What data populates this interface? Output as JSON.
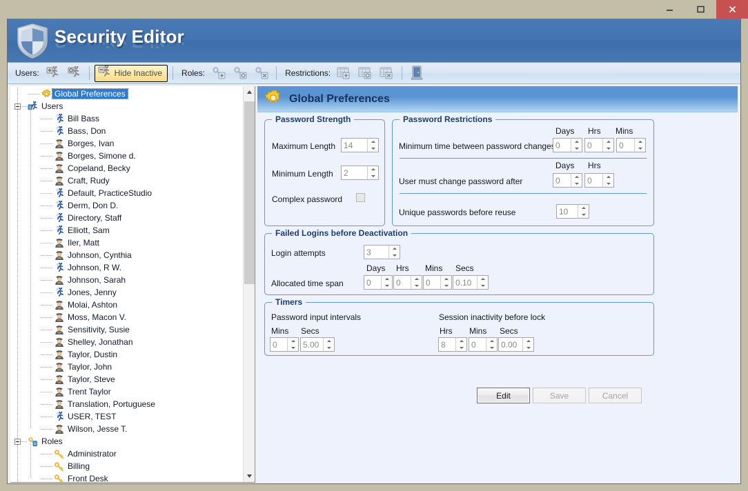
{
  "window": {
    "minimize_label": "Minimize",
    "maximize_label": "Maximize",
    "close_label": "Close"
  },
  "brand": {
    "title": "Security Editor",
    "shield_icon": "shield-icon"
  },
  "toolbar": {
    "users_label": "Users:",
    "add_user_icon": "add-user-icon",
    "edit_user_icon": "edit-user-icon",
    "hide_inactive_label": "Hide Inactive",
    "hide_inactive_icon": "hide-inactive-icon",
    "roles_label": "Roles:",
    "add_role_icon": "add-role-icon",
    "edit_role_icon": "edit-role-icon",
    "delete_role_icon": "delete-role-icon",
    "restrictions_label": "Restrictions:",
    "add_restriction_icon": "add-restriction-icon",
    "edit_restriction_icon": "edit-restriction-icon",
    "delete_restriction_icon": "delete-restriction-icon",
    "exit_icon": "exit-door-icon"
  },
  "tree": {
    "nodes": [
      {
        "label": "Global Preferences",
        "icon": "gear-icon",
        "level": 1,
        "selected": true,
        "expander": false
      },
      {
        "label": "Users",
        "icon": "users-icon",
        "level": 0,
        "selected": false,
        "expander": true
      },
      {
        "label": "Bill Bass",
        "icon": "active-user-icon",
        "level": 2,
        "selected": false,
        "expander": false
      },
      {
        "label": "Bass, Don",
        "icon": "active-user-icon",
        "level": 2,
        "selected": false,
        "expander": false
      },
      {
        "label": "Borges, Ivan",
        "icon": "inactive-user-icon",
        "level": 2,
        "selected": false,
        "expander": false
      },
      {
        "label": "Borges, Simone d.",
        "icon": "inactive-user-icon",
        "level": 2,
        "selected": false,
        "expander": false
      },
      {
        "label": "Copeland, Becky",
        "icon": "inactive-user-icon",
        "level": 2,
        "selected": false,
        "expander": false
      },
      {
        "label": "Craft, Rudy",
        "icon": "inactive-user-icon",
        "level": 2,
        "selected": false,
        "expander": false
      },
      {
        "label": "Default, PracticeStudio",
        "icon": "active-user-icon",
        "level": 2,
        "selected": false,
        "expander": false
      },
      {
        "label": "Derm, Don D.",
        "icon": "active-user-icon",
        "level": 2,
        "selected": false,
        "expander": false
      },
      {
        "label": "Directory, Staff",
        "icon": "active-user-icon",
        "level": 2,
        "selected": false,
        "expander": false
      },
      {
        "label": "Elliott, Sam",
        "icon": "active-user-icon",
        "level": 2,
        "selected": false,
        "expander": false
      },
      {
        "label": "Iler, Matt",
        "icon": "inactive-user-icon",
        "level": 2,
        "selected": false,
        "expander": false
      },
      {
        "label": "Johnson, Cynthia",
        "icon": "inactive-user-icon",
        "level": 2,
        "selected": false,
        "expander": false
      },
      {
        "label": "Johnson, R W.",
        "icon": "active-user-icon",
        "level": 2,
        "selected": false,
        "expander": false
      },
      {
        "label": "Johnson, Sarah",
        "icon": "inactive-user-icon",
        "level": 2,
        "selected": false,
        "expander": false
      },
      {
        "label": "Jones, Jenny",
        "icon": "active-user-icon",
        "level": 2,
        "selected": false,
        "expander": false
      },
      {
        "label": "Molai, Ashton",
        "icon": "inactive-user-icon",
        "level": 2,
        "selected": false,
        "expander": false
      },
      {
        "label": "Moss, Macon V.",
        "icon": "inactive-user-icon",
        "level": 2,
        "selected": false,
        "expander": false
      },
      {
        "label": "Sensitivity, Susie",
        "icon": "inactive-user-icon",
        "level": 2,
        "selected": false,
        "expander": false
      },
      {
        "label": "Shelley, Jonathan",
        "icon": "inactive-user-icon",
        "level": 2,
        "selected": false,
        "expander": false
      },
      {
        "label": "Taylor, Dustin",
        "icon": "inactive-user-icon",
        "level": 2,
        "selected": false,
        "expander": false
      },
      {
        "label": "Taylor, John",
        "icon": "inactive-user-icon",
        "level": 2,
        "selected": false,
        "expander": false
      },
      {
        "label": "Taylor, Steve",
        "icon": "inactive-user-icon",
        "level": 2,
        "selected": false,
        "expander": false
      },
      {
        "label": "Trent Taylor",
        "icon": "inactive-user-icon",
        "level": 2,
        "selected": false,
        "expander": false
      },
      {
        "label": "Translation, Portuguese",
        "icon": "inactive-user-icon",
        "level": 2,
        "selected": false,
        "expander": false
      },
      {
        "label": "USER, TEST",
        "icon": "active-user-icon",
        "level": 2,
        "selected": false,
        "expander": false
      },
      {
        "label": "Wilson, Jesse T.",
        "icon": "inactive-user-icon",
        "level": 2,
        "selected": false,
        "expander": false
      },
      {
        "label": "Roles",
        "icon": "roles-icon",
        "level": 0,
        "selected": false,
        "expander": true
      },
      {
        "label": "Administrator",
        "icon": "key-icon",
        "level": 2,
        "selected": false,
        "expander": false
      },
      {
        "label": "Billing",
        "icon": "key-icon",
        "level": 2,
        "selected": false,
        "expander": false
      },
      {
        "label": "Front Desk",
        "icon": "key-icon",
        "level": 2,
        "selected": false,
        "expander": false
      }
    ]
  },
  "detail": {
    "title": "Global Preferences",
    "title_icon": "gear-icon",
    "password_strength": {
      "title": "Password Strength",
      "maximum_length_label": "Maximum Length",
      "maximum_length_value": "14",
      "minimum_length_label": "Minimum Length",
      "minimum_length_value": "2",
      "complex_password_label": "Complex password",
      "complex_password_checked": false
    },
    "password_restrictions": {
      "title": "Password Restrictions",
      "min_time_label": "Minimum time between password changes",
      "min_time_days_head": "Days",
      "min_time_hrs_head": "Hrs",
      "min_time_mins_head": "Mins",
      "min_time_days_value": "0",
      "min_time_hrs_value": "0",
      "min_time_mins_value": "0",
      "must_change_label": "User must change password after",
      "must_change_days_head": "Days",
      "must_change_hrs_head": "Hrs",
      "must_change_days_value": "0",
      "must_change_hrs_value": "0",
      "unique_label": "Unique passwords before reuse",
      "unique_value": "10"
    },
    "failed_logins": {
      "title": "Failed Logins before Deactivation",
      "attempts_label": "Login attempts",
      "attempts_value": "3",
      "timespan_label": "Allocated time span",
      "days_head": "Days",
      "hrs_head": "Hrs",
      "mins_head": "Mins",
      "secs_head": "Secs",
      "days_value": "0",
      "hrs_value": "0",
      "mins_value": "0",
      "secs_value": "0.10"
    },
    "timers": {
      "title": "Timers",
      "input_intervals_label": "Password input intervals",
      "input_mins_head": "Mins",
      "input_secs_head": "Secs",
      "input_mins_value": "0",
      "input_secs_value": "5.00",
      "session_label": "Session inactivity before lock",
      "session_hrs_head": "Hrs",
      "session_mins_head": "Mins",
      "session_secs_head": "Secs",
      "session_hrs_value": "8",
      "session_mins_value": "0",
      "session_secs_value": "0.00"
    },
    "actions": {
      "edit_label": "Edit",
      "save_label": "Save",
      "cancel_label": "Cancel"
    }
  },
  "colors": {
    "brand_blue": "#4374b1",
    "panel_bg": "#eef2fc",
    "group_border": "#5e9ad6",
    "selection": "#2b7cd3",
    "accent_gold": "#f9dd84",
    "close_red": "#c75050"
  }
}
